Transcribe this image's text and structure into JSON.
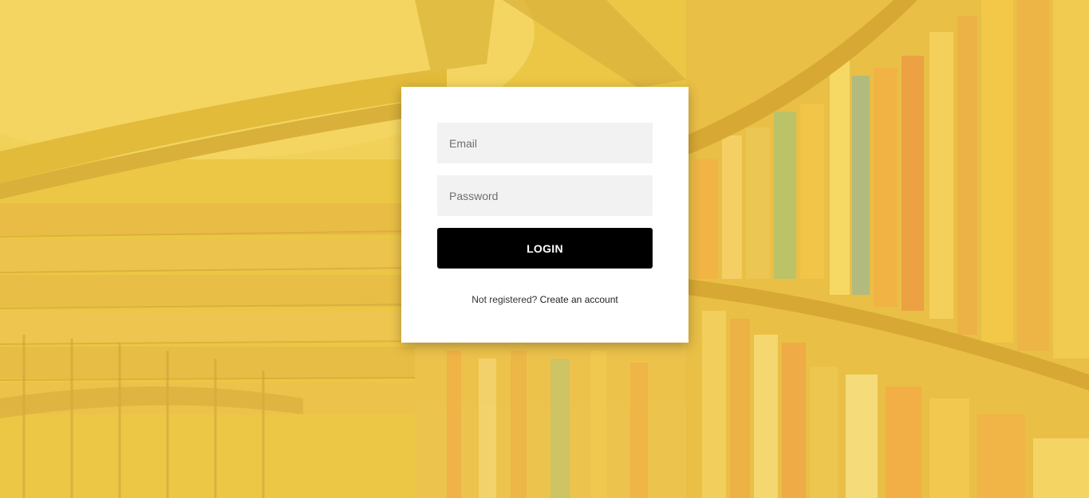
{
  "login_form": {
    "email_placeholder": "Email",
    "password_placeholder": "Password",
    "login_label": "LOGIN",
    "not_registered_text": "Not registered?",
    "create_account_link": "Create an account"
  },
  "colors": {
    "overlay_tint": "#f4cc3c",
    "card_bg": "#ffffff",
    "field_bg": "#f2f2f2",
    "button_bg": "#000000",
    "button_text": "#ffffff"
  },
  "icons": {
    "background": "library-bookshelves-image"
  }
}
